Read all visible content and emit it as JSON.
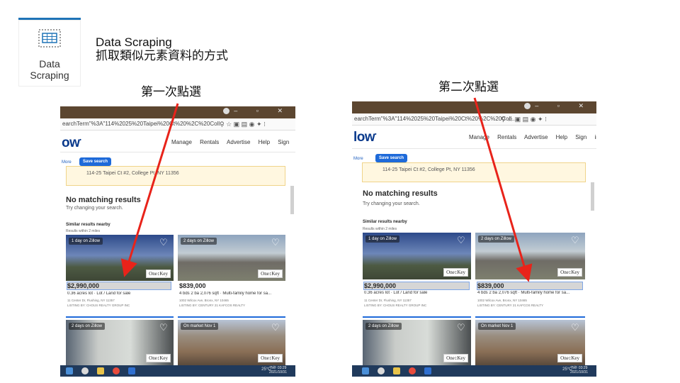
{
  "activity": {
    "icon": "data-scraping-icon",
    "label_line1": "Data",
    "label_line2": "Scraping"
  },
  "title": {
    "line1": "Data Scraping",
    "line2": "抓取類似元素資料的方式"
  },
  "captions": {
    "first": "第一次點選",
    "second": "第二次點選"
  },
  "arrow_color": "#e8231a",
  "accent": "#1e6ad9",
  "panels": [
    {
      "url": "earchTerm\"%3A\"114%2025%20Taipei%20Ct%20%2C%20Coll...",
      "logo": "ow",
      "nav": "Manage Rentals  Advertise  Help  Sign in",
      "more": "More",
      "save": "Save search",
      "address": "114-25 Taipei Ct #2, College Pt, NY 11356",
      "no_match": "No matching results",
      "try": "Try changing your search.",
      "similar": "Similar results nearby",
      "within": "Results within 2 miles",
      "cards": [
        {
          "tag": "1 day on Zillow",
          "price": "$2,990,000",
          "desc": "0.36 acres lot  · Lot / Land for sale",
          "addr": "11 Center Dr, Flushing, NY 11357",
          "listing": "LISTING BY: CHOUS REALTY GROUP INC",
          "brand": "One↕Key"
        },
        {
          "tag": "2 days on Zillow",
          "price": "$839,000",
          "desc": "4 bds  2 ba  2,076 sqft  · Multi-family home for sa...",
          "addr": "1002 Wilcox Ave, Bronx, NY 10465",
          "listing": "LISTING BY: CENTURY 21 KAFCOS REALTY",
          "brand": "One↕Key"
        },
        {
          "tag": "2 days on Zillow",
          "brand": "One↕Key"
        },
        {
          "tag": "On market Nov 1",
          "brand": "One↕Key"
        }
      ],
      "tray": "25°C  ^",
      "time": "下午 03:29",
      "date": "2021/10/31"
    },
    {
      "url": "earchTerm\"%3A\"114%2025%20Taipei%20Ct%20%2C%20Coll...",
      "logo": "low",
      "nav": "Manage Rentals  Advertise  Help  Sign in",
      "more": "More",
      "save": "Save search",
      "address": "114-25 Taipei Ct #2, College Pt, NY 11356",
      "no_match": "No matching results",
      "try": "Try changing your search.",
      "similar": "Similar results nearby",
      "within": "Results within 2 miles",
      "cards": [
        {
          "tag": "1 day on Zillow",
          "price": "$2,990,000",
          "desc": "0.36 acres lot  · Lot / Land for sale",
          "addr": "11 Center Dr, Flushing, NY 11357",
          "listing": "LISTING BY: CHOUS REALTY GROUP INC",
          "brand": "One↕Key"
        },
        {
          "tag": "2 days on Zillow",
          "price": "$839,000",
          "desc": "4 bds  2 ba  2,076 sqft  · Multi-family home for sa...",
          "addr": "1002 Wilcox Ave, Bronx, NY 10465",
          "listing": "LISTING BY: CENTURY 21 KAFCOS REALTY",
          "brand": "One↕Key"
        },
        {
          "tag": "2 days on Zillow",
          "brand": "One↕Key"
        },
        {
          "tag": "On market Nov 1",
          "brand": "One↕Key"
        }
      ],
      "tray": "25°C  ^",
      "time": "下午 03:29",
      "date": "2021/10/31"
    }
  ]
}
